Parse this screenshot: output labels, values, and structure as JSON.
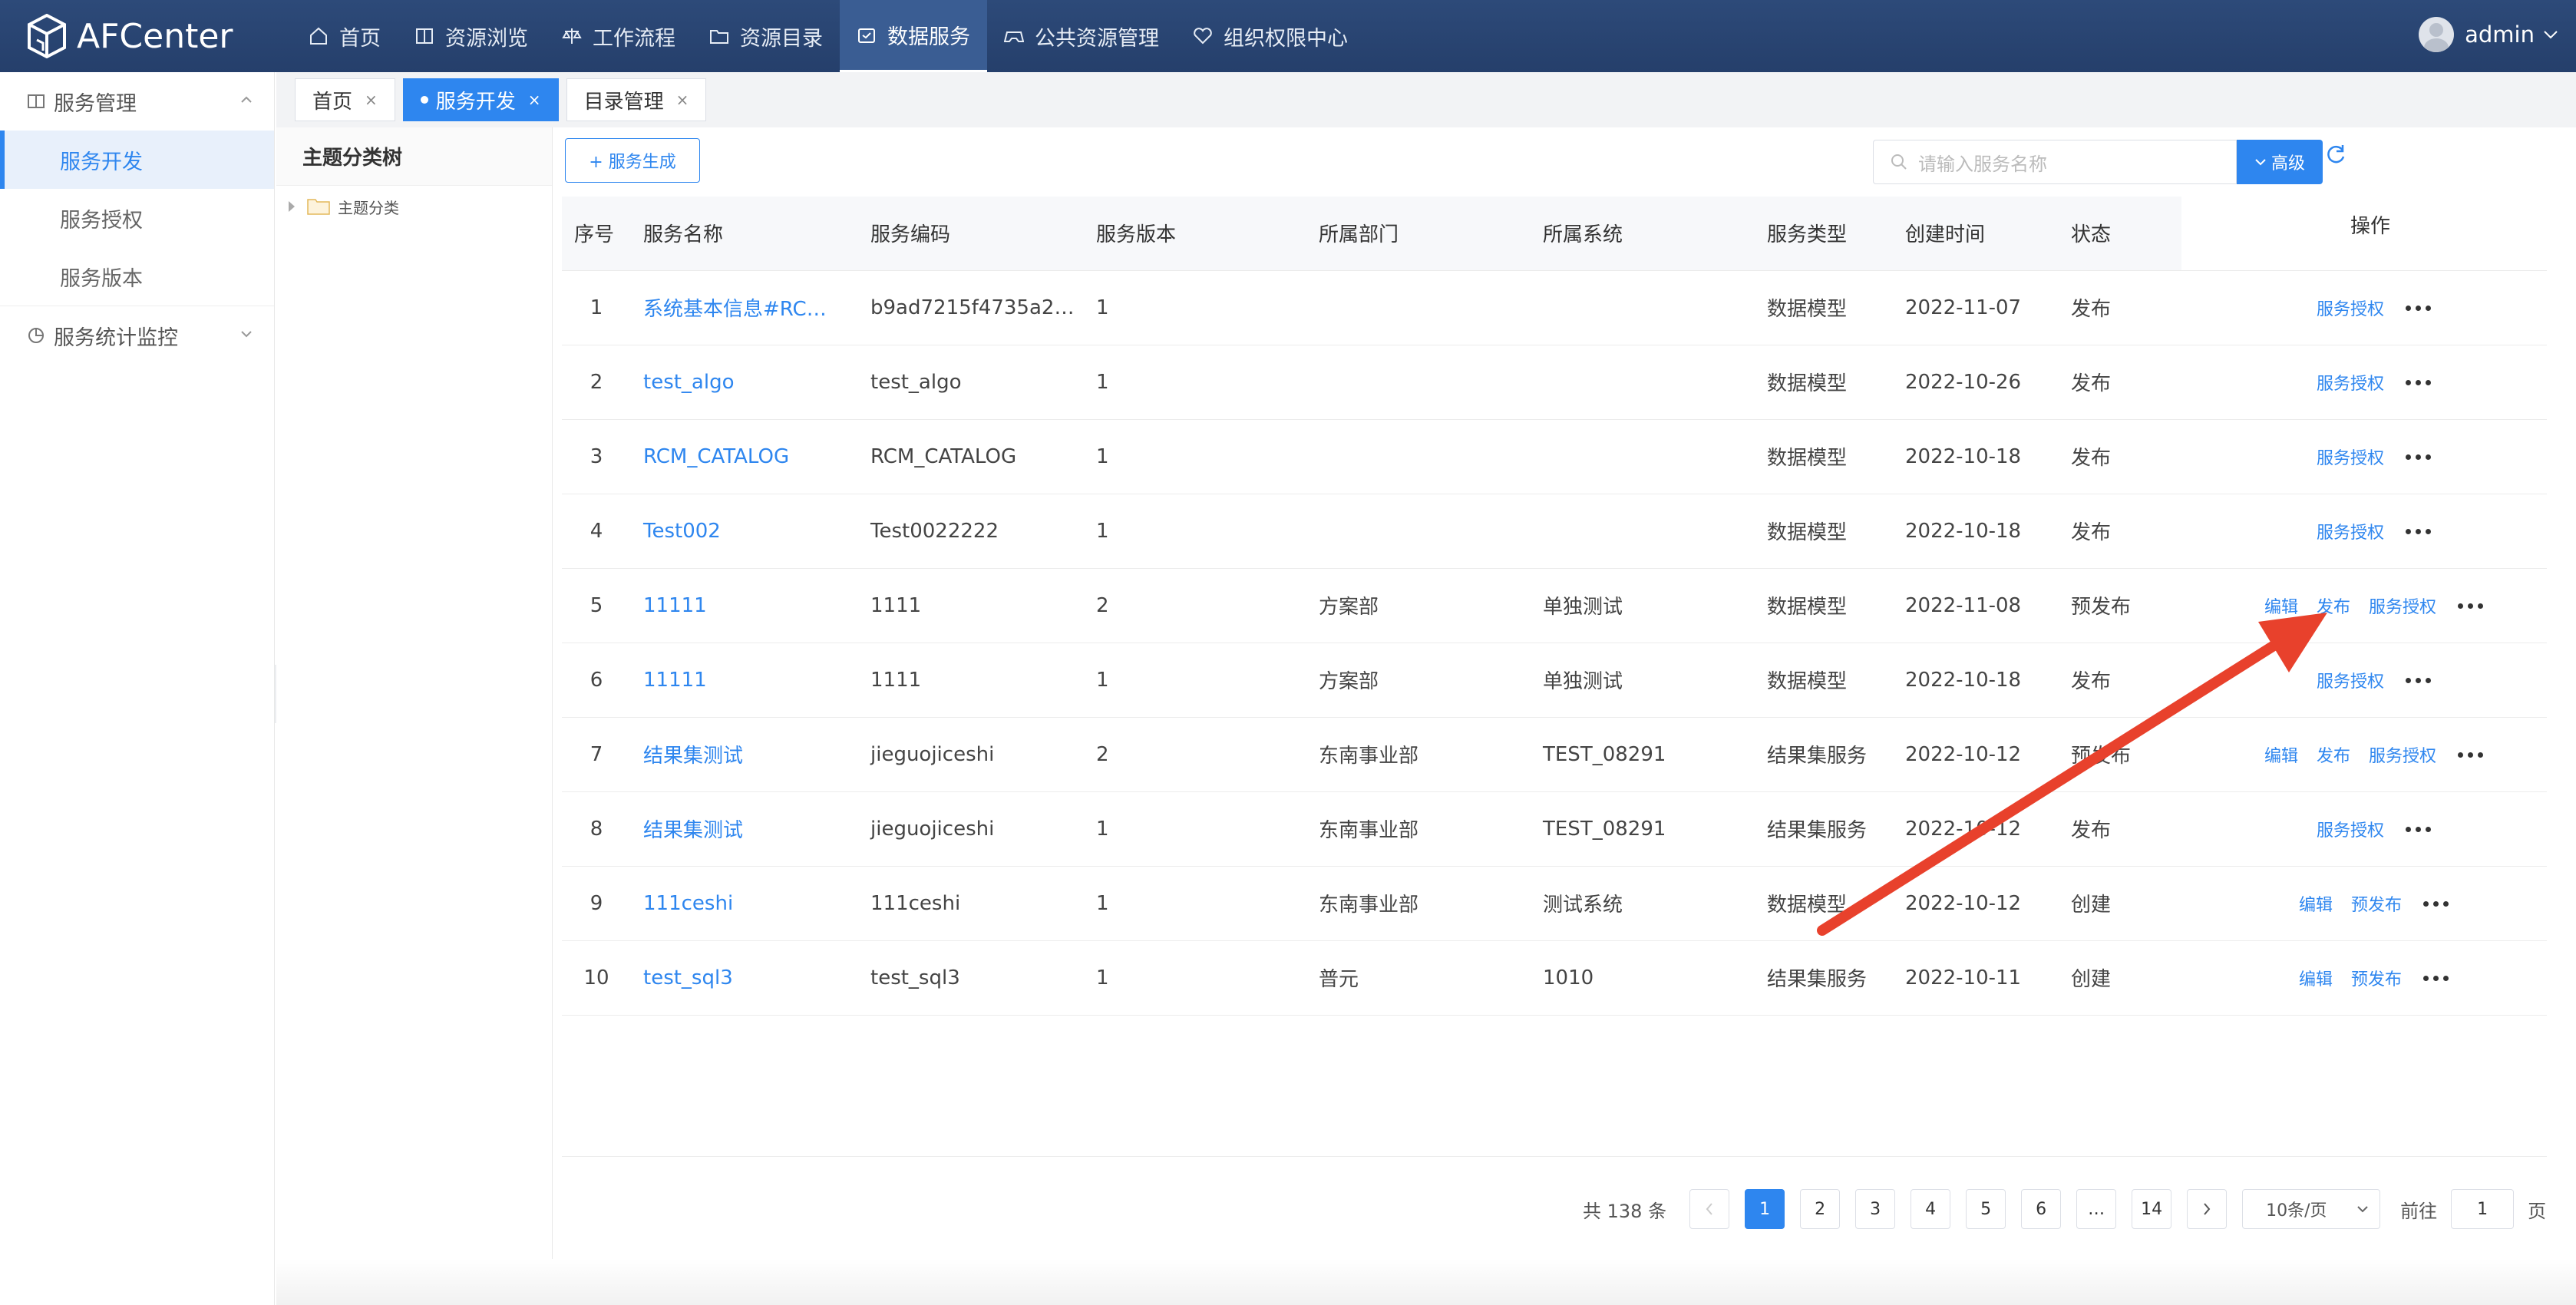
{
  "app": {
    "name": "AFCenter"
  },
  "nav": {
    "items": [
      {
        "label": "首页",
        "icon": "home-icon"
      },
      {
        "label": "资源浏览",
        "icon": "book-icon"
      },
      {
        "label": "工作流程",
        "icon": "scale-icon"
      },
      {
        "label": "资源目录",
        "icon": "folder-icon"
      },
      {
        "label": "数据服务",
        "icon": "box-icon",
        "active": true
      },
      {
        "label": "公共资源管理",
        "icon": "gamepad-icon"
      },
      {
        "label": "组织权限中心",
        "icon": "heart-icon"
      }
    ]
  },
  "user": {
    "name": "admin"
  },
  "sidebar": {
    "group1": {
      "label": "服务管理"
    },
    "items": [
      {
        "label": "服务开发",
        "active": true
      },
      {
        "label": "服务授权"
      },
      {
        "label": "服务版本"
      }
    ],
    "group2": {
      "label": "服务统计监控"
    }
  },
  "tabs": [
    {
      "label": "首页"
    },
    {
      "label": "服务开发",
      "active": true
    },
    {
      "label": "目录管理"
    }
  ],
  "tree": {
    "title": "主题分类树",
    "root": "主题分类"
  },
  "toolbar": {
    "generate_label": "+ 服务生成",
    "search_placeholder": "请输入服务名称",
    "advanced_label": "高级"
  },
  "table": {
    "columns": [
      "序号",
      "服务名称",
      "服务编码",
      "服务版本",
      "所属部门",
      "所属系统",
      "服务类型",
      "创建时间",
      "状态",
      "操作"
    ],
    "rows": [
      {
        "idx": "1",
        "name": "系统基本信息#RC…",
        "code": "b9ad7215f4735a2…",
        "version": "1",
        "dept": "",
        "system": "",
        "type": "数据模型",
        "created": "2022-11-07",
        "status": "发布",
        "ops": [
          "服务授权"
        ]
      },
      {
        "idx": "2",
        "name": "test_algo",
        "code": "test_algo",
        "version": "1",
        "dept": "",
        "system": "",
        "type": "数据模型",
        "created": "2022-10-26",
        "status": "发布",
        "ops": [
          "服务授权"
        ]
      },
      {
        "idx": "3",
        "name": "RCM_CATALOG",
        "code": "RCM_CATALOG",
        "version": "1",
        "dept": "",
        "system": "",
        "type": "数据模型",
        "created": "2022-10-18",
        "status": "发布",
        "ops": [
          "服务授权"
        ]
      },
      {
        "idx": "4",
        "name": "Test002",
        "code": "Test0022222",
        "version": "1",
        "dept": "",
        "system": "",
        "type": "数据模型",
        "created": "2022-10-18",
        "status": "发布",
        "ops": [
          "服务授权"
        ]
      },
      {
        "idx": "5",
        "name": "11111",
        "code": "1111",
        "version": "2",
        "dept": "方案部",
        "system": "单独测试",
        "type": "数据模型",
        "created": "2022-11-08",
        "status": "预发布",
        "ops": [
          "编辑",
          "发布",
          "服务授权"
        ]
      },
      {
        "idx": "6",
        "name": "11111",
        "code": "1111",
        "version": "1",
        "dept": "方案部",
        "system": "单独测试",
        "type": "数据模型",
        "created": "2022-10-18",
        "status": "发布",
        "ops": [
          "服务授权"
        ]
      },
      {
        "idx": "7",
        "name": "结果集测试",
        "code": "jieguojiceshi",
        "version": "2",
        "dept": "东南事业部",
        "system": "TEST_08291",
        "type": "结果集服务",
        "created": "2022-10-12",
        "status": "预发布",
        "ops": [
          "编辑",
          "发布",
          "服务授权"
        ]
      },
      {
        "idx": "8",
        "name": "结果集测试",
        "code": "jieguojiceshi",
        "version": "1",
        "dept": "东南事业部",
        "system": "TEST_08291",
        "type": "结果集服务",
        "created": "2022-10-12",
        "status": "发布",
        "ops": [
          "服务授权"
        ]
      },
      {
        "idx": "9",
        "name": "111ceshi",
        "code": "111ceshi",
        "version": "1",
        "dept": "东南事业部",
        "system": "测试系统",
        "type": "数据模型",
        "created": "2022-10-12",
        "status": "创建",
        "ops": [
          "编辑",
          "预发布"
        ]
      },
      {
        "idx": "10",
        "name": "test_sql3",
        "code": "test_sql3",
        "version": "1",
        "dept": "普元",
        "system": "1010",
        "type": "结果集服务",
        "created": "2022-10-11",
        "status": "创建",
        "ops": [
          "编辑",
          "预发布"
        ]
      }
    ]
  },
  "pagination": {
    "total_label": "共 138 条",
    "pages": [
      "1",
      "2",
      "3",
      "4",
      "5",
      "6",
      "…",
      "14"
    ],
    "current": "1",
    "page_size_label": "10条/页",
    "goto_prefix": "前往",
    "goto_value": "1",
    "goto_suffix": "页"
  },
  "colors": {
    "topbar": "#2d4a79",
    "accent": "#2e86ef",
    "annotation": "#e8412c"
  }
}
